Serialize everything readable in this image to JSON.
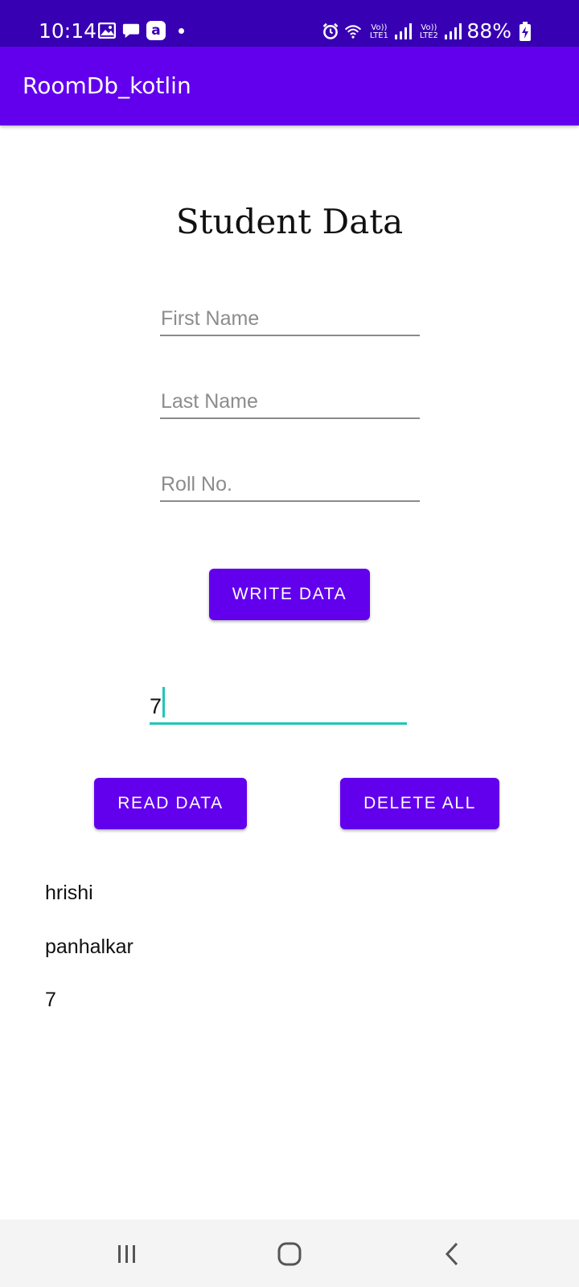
{
  "status_bar": {
    "time": "10:14",
    "left_icons": [
      "gallery-icon",
      "message-icon",
      "amazon-icon",
      "notification-dot-icon"
    ],
    "right_icons": [
      "alarm-icon",
      "wifi-icon",
      "volte-lte1-signal-icon",
      "volte-lte2-signal-icon",
      "battery-charging-icon"
    ],
    "sim1_label_top": "Vo))",
    "sim1_label_bottom": "LTE1",
    "sim2_label_top": "Vo))",
    "sim2_label_bottom": "LTE2",
    "battery": "88%",
    "background": "#3700b3"
  },
  "app_bar": {
    "title": "RoomDb_kotlin",
    "background": "#6200ee"
  },
  "form": {
    "title": "Student Data",
    "first_name": {
      "value": "",
      "placeholder": "First Name"
    },
    "last_name": {
      "value": "",
      "placeholder": "Last Name"
    },
    "roll_no": {
      "value": "",
      "placeholder": "Roll No."
    },
    "write_button": "WRITE DATA"
  },
  "query": {
    "roll_input_value": "7",
    "read_button": "READ DATA",
    "delete_button": "DELETE ALL",
    "accent": "#1fc7b8"
  },
  "result": {
    "first_name": "hrishi",
    "last_name": "panhalkar",
    "roll_no": "7"
  },
  "nav_bar": {
    "buttons": [
      "recent-apps-icon",
      "home-icon",
      "back-icon"
    ]
  }
}
